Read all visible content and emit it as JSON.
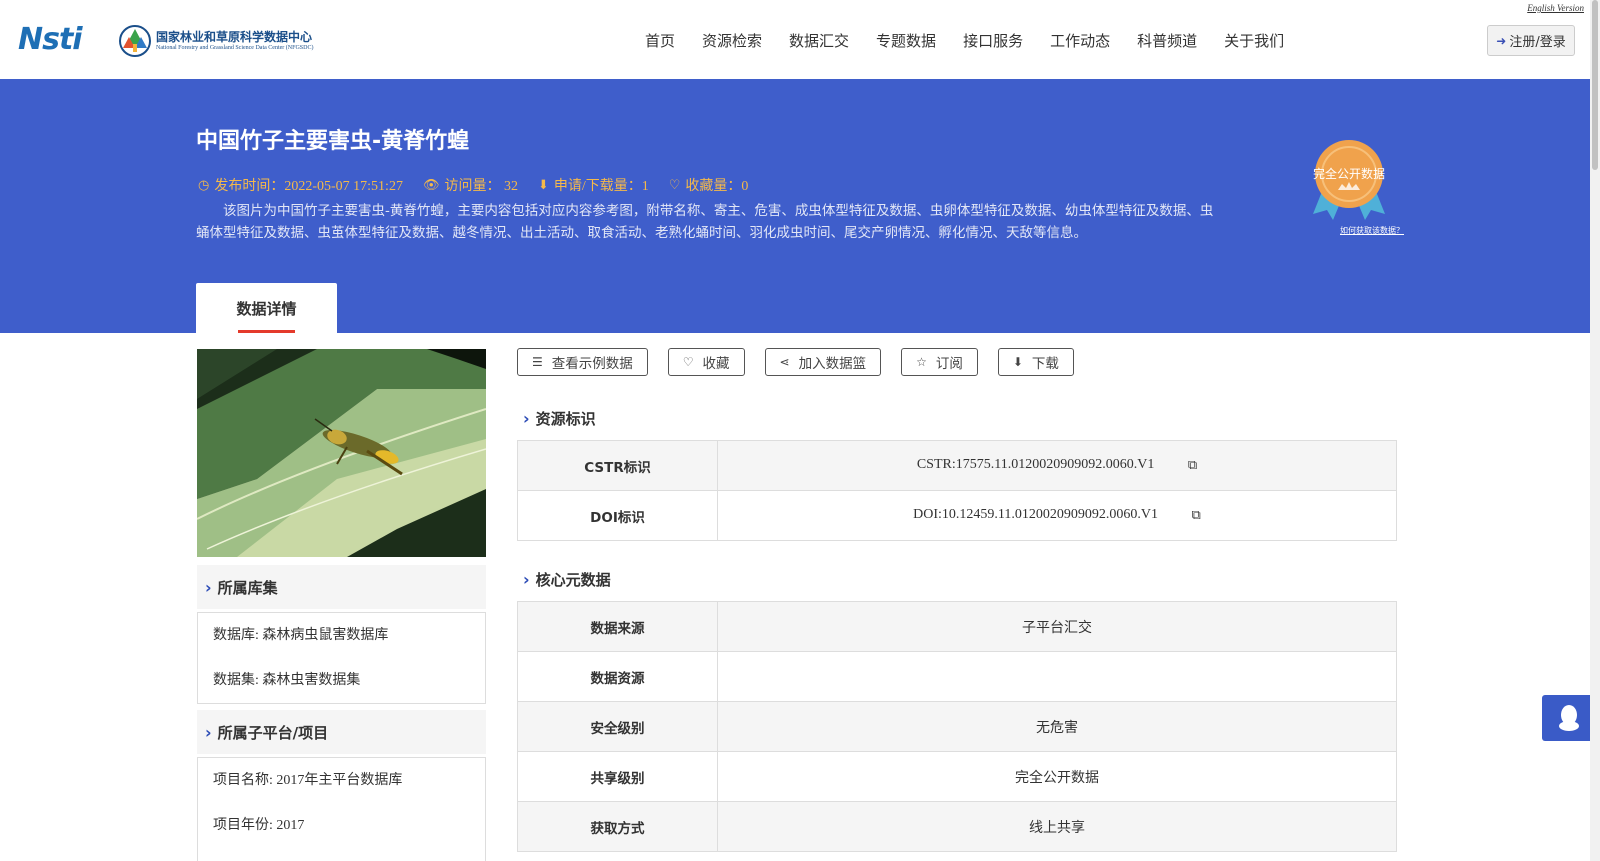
{
  "header": {
    "logo_nsti": "Nsti",
    "logo_cn": "国家林业和草原科学数据中心",
    "logo_en": "National Forestry and Grassland Science Data Center (NFGSDC)",
    "english_version": "English Version",
    "nav": [
      "首页",
      "资源检索",
      "数据汇交",
      "专题数据",
      "接口服务",
      "工作动态",
      "科普频道",
      "关于我们"
    ],
    "login_label": "注册/登录"
  },
  "banner": {
    "title": "中国竹子主要害虫-黄脊竹蝗",
    "publish_time": "发布时间：2022-05-07 17:51:27",
    "visits": "访问量： 32",
    "downloads": "申请/下载量：1",
    "favorites": "收藏量：0",
    "description": "该图片为中国竹子主要害虫-黄脊竹蝗，主要内容包括对应内容参考图，附带名称、寄主、危害、成虫体型特征及数据、虫卵体型特征及数据、幼虫体型特征及数据、虫蛹体型特征及数据、虫茧体型特征及数据、越冬情况、出土活动、取食活动、老熟化蛹时间、羽化成虫时间、尾交产卵情况、孵化情况、天敌等信息。",
    "badge_text": "完全公开数据",
    "badge_link": "如何获取该数据？",
    "tab_label": "数据详情"
  },
  "sidebar": {
    "library_title": "所属库集",
    "library_lines": [
      "数据库: 森林病虫鼠害数据库",
      "数据集: 森林虫害数据集"
    ],
    "project_title": "所属子平台/项目",
    "project_lines": [
      "项目名称: 2017年主平台数据库",
      "项目年份: 2017"
    ]
  },
  "actions": [
    "查看示例数据",
    "收藏",
    "加入数据篮",
    "订阅",
    "下载"
  ],
  "resource_id": {
    "title": "资源标识",
    "rows": [
      {
        "key": "CSTR标识",
        "value": "CSTR:17575.11.0120020909092.0060.V1"
      },
      {
        "key": "DOI标识",
        "value": "DOI:10.12459.11.0120020909092.0060.V1"
      }
    ]
  },
  "core_meta": {
    "title": "核心元数据",
    "rows": [
      {
        "key": "数据来源",
        "value": "子平台汇交"
      },
      {
        "key": "数据资源",
        "value": ""
      },
      {
        "key": "安全级别",
        "value": "无危害"
      },
      {
        "key": "共享级别",
        "value": "完全公开数据"
      },
      {
        "key": "获取方式",
        "value": "线上共享"
      }
    ]
  },
  "colors": {
    "banner": "#3f5ecb",
    "accent": "#2b4bb6",
    "meta_text": "#f5b94a",
    "tab_underline": "#e43a2b"
  },
  "icons": [
    "clock-icon",
    "eye-icon",
    "download-icon",
    "heart-icon",
    "database-icon",
    "share-icon",
    "star-icon",
    "copy-icon",
    "qq-icon",
    "sign-in-icon"
  ]
}
